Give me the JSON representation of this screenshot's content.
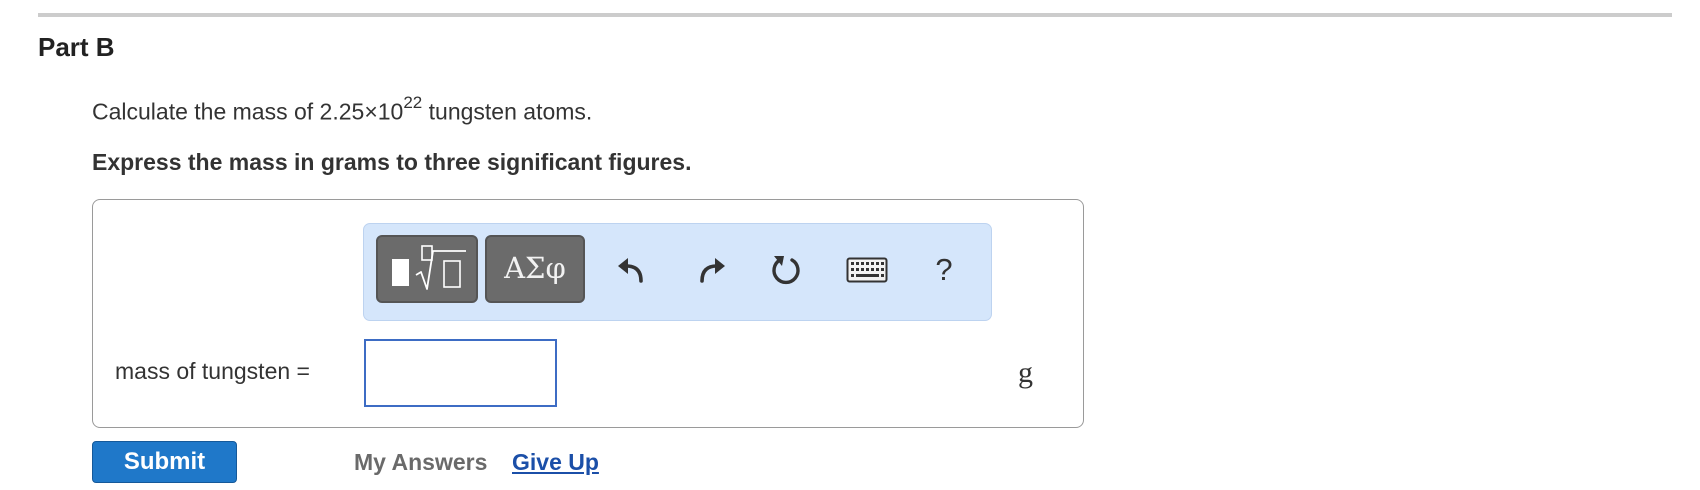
{
  "part": {
    "title": "Part B"
  },
  "question": {
    "prefix": "Calculate the mass of 2.25×10",
    "exponent": "22",
    "suffix": " tungsten atoms.",
    "instruction": "Express the mass in grams to three significant figures."
  },
  "toolbar": {
    "templates_icon": "templates-sqrt-icon",
    "greek_label": "ΑΣφ",
    "undo_icon": "undo-icon",
    "redo_icon": "redo-icon",
    "reset_icon": "reset-icon",
    "keyboard_icon": "keyboard-icon",
    "help_label": "?"
  },
  "answer": {
    "label": "mass of tungsten =",
    "value": "",
    "unit": "g"
  },
  "actions": {
    "submit_label": "Submit",
    "my_answers_label": "My Answers",
    "give_up_label": "Give Up"
  },
  "colors": {
    "toolbar_bg": "#d5e6fb",
    "toolbar_button": "#6b6b6b",
    "input_border": "#3d6cc4",
    "submit_bg": "#1f78c9",
    "link": "#1b4fa8",
    "muted_link": "#6a6a6a"
  }
}
